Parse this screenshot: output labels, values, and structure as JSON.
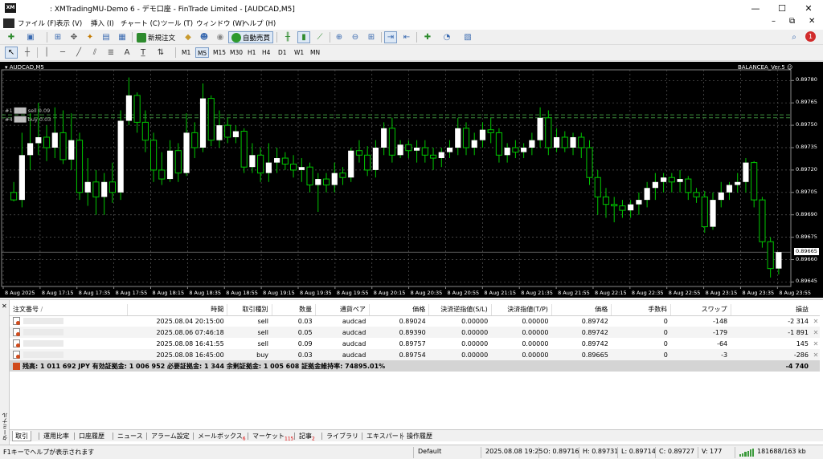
{
  "window": {
    "title": ": XMTradingMU-Demo 6 - デモ口座 - FinTrade Limited - [AUDCAD,M5]",
    "logo_text": "XM",
    "btn_min": "—",
    "btn_max": "☐",
    "btn_close": "✕"
  },
  "menu": {
    "items": [
      "ファイル (F)",
      "表示 (V)",
      "挿入 (I)",
      "チャート (C)",
      "ツール (T)",
      "ウィンドウ (W)",
      "ヘルプ (H)"
    ],
    "min": "–",
    "restore": "⧉",
    "close": "✕"
  },
  "toolbar": {
    "new_order": "新規注文",
    "autotrade": "自動売買",
    "notification_count": "1",
    "text_tool": "A"
  },
  "timeframes": [
    "M1",
    "M5",
    "M15",
    "M30",
    "H1",
    "H4",
    "D1",
    "W1",
    "MN"
  ],
  "active_timeframe": "M5",
  "chart": {
    "symbol_label": "▾ AUDCAD,M5",
    "ea_label": "BALANCEA_Ver.5 ☺",
    "order_label_1": "#1 ███ sell 0.09",
    "order_label_2": "#4 ███ buy 0.03",
    "current_price": "0.89665",
    "price_labels": [
      "0.89780",
      "0.89765",
      "0.89750",
      "0.89735",
      "0.89720",
      "0.89705",
      "0.89690",
      "0.89675",
      "0.89660",
      "0.89645"
    ],
    "time_labels": [
      "8 Aug 2025",
      "8 Aug 17:15",
      "8 Aug 17:35",
      "8 Aug 17:55",
      "8 Aug 18:15",
      "8 Aug 18:35",
      "8 Aug 18:55",
      "8 Aug 19:15",
      "8 Aug 19:35",
      "8 Aug 19:55",
      "8 Aug 20:15",
      "8 Aug 20:35",
      "8 Aug 20:55",
      "8 Aug 21:15",
      "8 Aug 21:35",
      "8 Aug 21:55",
      "8 Aug 22:15",
      "8 Aug 22:35",
      "8 Aug 22:55",
      "8 Aug 23:15",
      "8 Aug 23:35",
      "8 Aug 23:55"
    ],
    "colors": {
      "bull": "#ffffff",
      "bear": "#000000",
      "wick": "#00c800",
      "grid": "#5a5a5a",
      "order_line": "#3c8c3c"
    },
    "order_line_prices": [
      0.89755,
      0.89757
    ],
    "candles": [
      [
        0.89705,
        0.89712,
        0.897,
        0.89699
      ],
      [
        0.897,
        0.89745,
        0.8973,
        0.89695
      ],
      [
        0.8973,
        0.89758,
        0.89738,
        0.8972
      ],
      [
        0.89738,
        0.89765,
        0.89742,
        0.8973
      ],
      [
        0.89742,
        0.8975,
        0.89735,
        0.89726
      ],
      [
        0.89735,
        0.89762,
        0.89745,
        0.89728
      ],
      [
        0.89745,
        0.8976,
        0.89727,
        0.89724
      ],
      [
        0.89727,
        0.89758,
        0.8974,
        0.8972
      ],
      [
        0.8974,
        0.89745,
        0.89705,
        0.897
      ],
      [
        0.89705,
        0.89728,
        0.89712,
        0.89696
      ],
      [
        0.89712,
        0.8972,
        0.89702,
        0.8969
      ],
      [
        0.89702,
        0.89718,
        0.89712,
        0.8969
      ],
      [
        0.89712,
        0.89725,
        0.89705,
        0.89698
      ],
      [
        0.89705,
        0.8976,
        0.89753,
        0.897
      ],
      [
        0.89753,
        0.89782,
        0.8977,
        0.8975
      ],
      [
        0.8977,
        0.89772,
        0.89752,
        0.89745
      ],
      [
        0.89752,
        0.8976,
        0.8974,
        0.89732
      ],
      [
        0.8974,
        0.89745,
        0.8972,
        0.89712
      ],
      [
        0.8972,
        0.89732,
        0.89714,
        0.8971
      ],
      [
        0.89714,
        0.8974,
        0.89733,
        0.89712
      ],
      [
        0.89733,
        0.89738,
        0.89718,
        0.89712
      ],
      [
        0.89718,
        0.89758,
        0.89745,
        0.89716
      ],
      [
        0.89745,
        0.89752,
        0.89735,
        0.89728
      ],
      [
        0.89735,
        0.89778,
        0.89768,
        0.89732
      ],
      [
        0.89768,
        0.8977,
        0.8974,
        0.89736
      ],
      [
        0.8974,
        0.8976,
        0.8975,
        0.89735
      ],
      [
        0.8975,
        0.89755,
        0.89742,
        0.89738
      ],
      [
        0.89742,
        0.8975,
        0.89746,
        0.89738
      ],
      [
        0.89746,
        0.89748,
        0.89722,
        0.89718
      ],
      [
        0.89722,
        0.89738,
        0.8973,
        0.89718
      ],
      [
        0.8973,
        0.89735,
        0.89718,
        0.89712
      ],
      [
        0.89718,
        0.89738,
        0.89725,
        0.89712
      ],
      [
        0.89725,
        0.89735,
        0.89728,
        0.89718
      ],
      [
        0.89728,
        0.89732,
        0.89724,
        0.8972
      ],
      [
        0.89724,
        0.8973,
        0.8972,
        0.89715
      ],
      [
        0.8972,
        0.89728,
        0.89722,
        0.89712
      ],
      [
        0.89722,
        0.89725,
        0.8971,
        0.89705
      ],
      [
        0.8971,
        0.89718,
        0.89714,
        0.89692
      ],
      [
        0.89714,
        0.89718,
        0.8971,
        0.89705
      ],
      [
        0.8971,
        0.89725,
        0.89718,
        0.89705
      ],
      [
        0.89718,
        0.89722,
        0.89715,
        0.8971
      ],
      [
        0.89715,
        0.89735,
        0.89733,
        0.89712
      ],
      [
        0.89733,
        0.8974,
        0.8973,
        0.89725
      ],
      [
        0.8973,
        0.89736,
        0.8972,
        0.89716
      ],
      [
        0.8972,
        0.8974,
        0.89735,
        0.89715
      ],
      [
        0.89735,
        0.89752,
        0.89748,
        0.8973
      ],
      [
        0.89748,
        0.89755,
        0.8973,
        0.89725
      ],
      [
        0.8973,
        0.8974,
        0.89737,
        0.89728
      ],
      [
        0.89737,
        0.8974,
        0.89733,
        0.89728
      ],
      [
        0.89733,
        0.8974,
        0.89735,
        0.89725
      ],
      [
        0.89735,
        0.8974,
        0.8973,
        0.89725
      ],
      [
        0.8973,
        0.89735,
        0.89728,
        0.8972
      ],
      [
        0.89728,
        0.89735,
        0.89732,
        0.89722
      ],
      [
        0.89732,
        0.8974,
        0.89735,
        0.89728
      ],
      [
        0.89735,
        0.89755,
        0.89748,
        0.8973
      ],
      [
        0.89748,
        0.89752,
        0.89735,
        0.8973
      ],
      [
        0.89735,
        0.89745,
        0.8974,
        0.8973
      ],
      [
        0.8974,
        0.89752,
        0.89747,
        0.89735
      ],
      [
        0.89747,
        0.89755,
        0.89745,
        0.89738
      ],
      [
        0.89745,
        0.89748,
        0.8973,
        0.89725
      ],
      [
        0.8973,
        0.89738,
        0.89735,
        0.89725
      ],
      [
        0.89735,
        0.8974,
        0.89732,
        0.89728
      ],
      [
        0.89732,
        0.89738,
        0.89735,
        0.89728
      ],
      [
        0.89735,
        0.89745,
        0.8974,
        0.8973
      ],
      [
        0.8974,
        0.89762,
        0.89755,
        0.89735
      ],
      [
        0.89755,
        0.8976,
        0.89735,
        0.8973
      ],
      [
        0.89735,
        0.89748,
        0.89742,
        0.89732
      ],
      [
        0.89742,
        0.89746,
        0.89735,
        0.89732
      ],
      [
        0.89735,
        0.89745,
        0.89742,
        0.8973
      ],
      [
        0.89742,
        0.89745,
        0.89735,
        0.89728
      ],
      [
        0.89735,
        0.8974,
        0.89715,
        0.8971
      ],
      [
        0.89715,
        0.8972,
        0.89702,
        0.8969
      ],
      [
        0.89702,
        0.89708,
        0.89697,
        0.89688
      ],
      [
        0.89697,
        0.89702,
        0.89696,
        0.89685
      ],
      [
        0.89696,
        0.897,
        0.89693,
        0.89688
      ],
      [
        0.89693,
        0.897,
        0.89697,
        0.89688
      ],
      [
        0.89697,
        0.89705,
        0.897,
        0.8969
      ],
      [
        0.897,
        0.89712,
        0.89708,
        0.89695
      ],
      [
        0.89708,
        0.89718,
        0.89712,
        0.897
      ],
      [
        0.89712,
        0.89718,
        0.89715,
        0.89705
      ],
      [
        0.89715,
        0.89718,
        0.89712,
        0.89705
      ],
      [
        0.89712,
        0.8972,
        0.89714,
        0.89705
      ],
      [
        0.89714,
        0.89716,
        0.89705,
        0.897
      ],
      [
        0.89705,
        0.89708,
        0.89702,
        0.89698
      ],
      [
        0.89702,
        0.89706,
        0.89682,
        0.89678
      ],
      [
        0.89682,
        0.89705,
        0.897,
        0.8968
      ],
      [
        0.897,
        0.89712,
        0.89705,
        0.89695
      ],
      [
        0.89705,
        0.89712,
        0.8971,
        0.897
      ],
      [
        0.8971,
        0.89718,
        0.89712,
        0.89705
      ],
      [
        0.89712,
        0.89728,
        0.89725,
        0.89705
      ],
      [
        0.89725,
        0.89726,
        0.897,
        0.89695
      ],
      [
        0.897,
        0.89702,
        0.89672,
        0.89668
      ],
      [
        0.89672,
        0.89675,
        0.89654,
        0.89648
      ],
      [
        0.89654,
        0.89665,
        0.89665,
        0.8965
      ]
    ]
  },
  "orders": {
    "headers": [
      "注文番号",
      "/",
      "時間",
      "取引種別",
      "数量",
      "通貨ペア",
      "価格",
      "決済逆指値(S/L)",
      "決済指値(T/P)",
      "価格",
      "手数料",
      "スワップ",
      "損益"
    ],
    "rows": [
      {
        "time": "2025.08.04 20:15:00",
        "type": "sell",
        "volume": "0.03",
        "symbol": "audcad",
        "open_price": "0.89024",
        "sl": "0.00000",
        "tp": "0.00000",
        "price": "0.89742",
        "commission": "0",
        "swap": "-148",
        "profit": "-2 314"
      },
      {
        "time": "2025.08.06 07:46:18",
        "type": "sell",
        "volume": "0.05",
        "symbol": "audcad",
        "open_price": "0.89390",
        "sl": "0.00000",
        "tp": "0.00000",
        "price": "0.89742",
        "commission": "0",
        "swap": "-179",
        "profit": "-1 891"
      },
      {
        "time": "2025.08.08 16:41:55",
        "type": "sell",
        "volume": "0.09",
        "symbol": "audcad",
        "open_price": "0.89757",
        "sl": "0.00000",
        "tp": "0.00000",
        "price": "0.89742",
        "commission": "0",
        "swap": "-64",
        "profit": "145"
      },
      {
        "time": "2025.08.08 16:45:00",
        "type": "buy",
        "volume": "0.03",
        "symbol": "audcad",
        "open_price": "0.89754",
        "sl": "0.00000",
        "tp": "0.00000",
        "price": "0.89665",
        "commission": "0",
        "swap": "-3",
        "profit": "-286"
      }
    ],
    "summary_text": "残高: 1 011 692 JPY  有効証拠金: 1 006 952  必要証拠金: 1 344  余剰証拠金: 1 005 608  証拠金維持率: 74895.01%",
    "summary_profit": "-4 740",
    "delete_glyph": "✕"
  },
  "terminal": {
    "close_glyph": "✕",
    "vertical_label": "ターミナル",
    "tabs": [
      {
        "label": "取引",
        "badge": ""
      },
      {
        "label": "運用比率",
        "badge": ""
      },
      {
        "label": "口座履歴",
        "badge": ""
      },
      {
        "label": "ニュース",
        "badge": ""
      },
      {
        "label": "アラーム設定",
        "badge": ""
      },
      {
        "label": "メールボックス",
        "badge": "6"
      },
      {
        "label": "マーケット",
        "badge": "115"
      },
      {
        "label": "記事",
        "badge": "2"
      },
      {
        "label": "ライブラリ",
        "badge": ""
      },
      {
        "label": "エキスパート",
        "badge": ""
      },
      {
        "label": "操作履歴",
        "badge": ""
      }
    ]
  },
  "statusbar": {
    "help": "F1キーでヘルプが表示されます",
    "profile": "Default",
    "datetime": "2025.08.08 19:25",
    "open": "O: 0.89716",
    "high": "H: 0.89731",
    "low": "L: 0.89714",
    "close": "C: 0.89727",
    "volume": "V: 177",
    "traffic": "181688/163 kb"
  }
}
